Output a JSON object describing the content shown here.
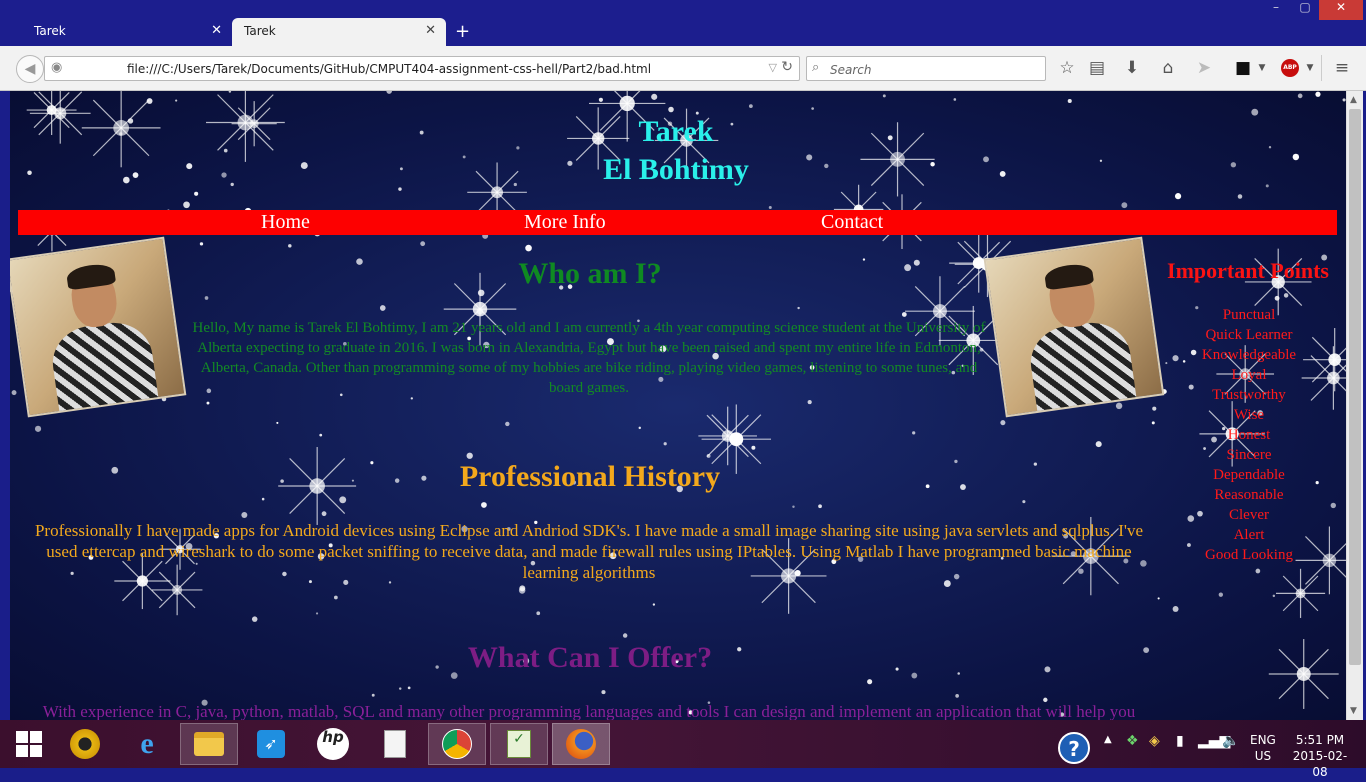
{
  "browser": {
    "tabs": [
      {
        "title": "Tarek",
        "active": false
      },
      {
        "title": "Tarek",
        "active": true
      }
    ],
    "new_tab": "+",
    "url": "file:///C:/Users/Tarek/Documents/GitHub/CMPUT404-assignment-css-hell/Part2/bad.html",
    "search_placeholder": "Search",
    "abp_label": "ABP"
  },
  "page": {
    "name_first": "Tarek",
    "name_last": "El Bohtimy",
    "menu": [
      "Home",
      "More Info",
      "Contact"
    ],
    "who_heading": "Who am I?",
    "who_text": "Hello, My name is Tarek El Bohtimy, I am 21 years old and I am currently a 4th year computing science student at the University of Alberta expecting to graduate in 2016. I was born in Alexandria, Egypt but have been raised and spent my entire life in Edmonton, Alberta, Canada. Other than programming some of my hobbies are bike riding, playing video games, listening to some tunes, and board games.",
    "important_heading": "Important Points",
    "points": [
      "Punctual",
      "Quick Learner",
      "Knowledgeable",
      "Loyal",
      "Trustworthy",
      "Wise",
      "Honest",
      "Sincere",
      "Dependable",
      "Reasonable",
      "Clever",
      "Alert",
      "Good Looking"
    ],
    "prof_heading": "Professional History",
    "prof_text": "Professionally I have made apps for Android devices using Eclipse and Andriod SDK's. I have made a small image sharing site using java servlets and sqlplus. I've used ettercap and wireshark to do some packet sniffing to receive data, and made firewall rules using IPtables. Using Matlab I have programmed basic machine learning algorithms",
    "offer_heading": "What Can I Offer?",
    "offer_text": "With experience in C, java, python, matlab, SQL and many other programming languages and tools I can design and implement an application that will help you"
  },
  "taskbar": {
    "language": "ENG",
    "region": "US",
    "time": "5:51 PM",
    "date": "2015-02-08",
    "help": "?"
  },
  "colors": {
    "name": "#2af0ea",
    "menu_bg": "#fd0000",
    "who": "#0f8a22",
    "important": "#fb1313",
    "professional": "#f3a81c",
    "offer": "#7d1d84"
  }
}
